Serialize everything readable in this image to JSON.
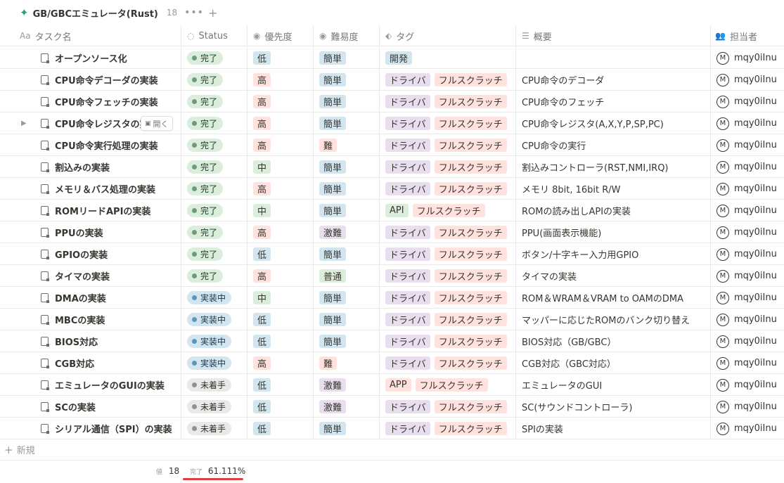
{
  "database": {
    "title": "GB/GBCエミュレータ(Rust)",
    "count": "18",
    "more": "•••",
    "add": "+"
  },
  "columns": [
    {
      "label": "タスク名",
      "icon": "Aa"
    },
    {
      "label": "Status",
      "icon": "◌"
    },
    {
      "label": "優先度",
      "icon": "◉"
    },
    {
      "label": "難易度",
      "icon": "◉"
    },
    {
      "label": "タグ",
      "icon": "⬖"
    },
    {
      "label": "概要",
      "icon": "☰"
    },
    {
      "label": "担当者",
      "icon": "👥"
    }
  ],
  "open_button": {
    "label": "開く",
    "icon": "▣"
  },
  "rows": [
    {
      "name": "オープンソース化",
      "status": "完了",
      "priority": "低",
      "difficulty": "簡単",
      "tags": [
        "開発"
      ],
      "summary": "",
      "owner": "mqy0iInu",
      "avatar": "M"
    },
    {
      "name": "CPU命令デコーダの実装",
      "status": "完了",
      "priority": "高",
      "difficulty": "簡単",
      "tags": [
        "ドライバ",
        "フルスクラッチ"
      ],
      "summary": "CPU命令のデコーダ",
      "owner": "mqy0iInu",
      "avatar": "M"
    },
    {
      "name": "CPU命令フェッチの実装",
      "status": "完了",
      "priority": "高",
      "difficulty": "簡単",
      "tags": [
        "ドライバ",
        "フルスクラッチ"
      ],
      "summary": "CPU命令のフェッチ",
      "owner": "mqy0iInu",
      "avatar": "M"
    },
    {
      "name": "CPU命令レジスタの実",
      "status": "完了",
      "priority": "高",
      "difficulty": "簡単",
      "tags": [
        "ドライバ",
        "フルスクラッチ"
      ],
      "summary": "CPU命令レジスタ(A,X,Y,P,SP,PC)",
      "owner": "mqy0iInu",
      "avatar": "M"
    },
    {
      "name": "CPU命令実行処理の実装",
      "status": "完了",
      "priority": "高",
      "difficulty": "難",
      "tags": [
        "ドライバ",
        "フルスクラッチ"
      ],
      "summary": "CPU命令の実行",
      "owner": "mqy0iInu",
      "avatar": "M"
    },
    {
      "name": "割込みの実装",
      "status": "完了",
      "priority": "中",
      "difficulty": "簡単",
      "tags": [
        "ドライバ",
        "フルスクラッチ"
      ],
      "summary": "割込みコントローラ(RST,NMI,IRQ)",
      "owner": "mqy0iInu",
      "avatar": "M"
    },
    {
      "name": "メモリ＆バス処理の実装",
      "status": "完了",
      "priority": "高",
      "difficulty": "簡単",
      "tags": [
        "ドライバ",
        "フルスクラッチ"
      ],
      "summary": "メモリ 8bit, 16bit R/W",
      "owner": "mqy0iInu",
      "avatar": "M"
    },
    {
      "name": "ROMリードAPIの実装",
      "status": "完了",
      "priority": "中",
      "difficulty": "簡単",
      "tags": [
        "API",
        "フルスクラッチ"
      ],
      "summary": "ROMの読み出しAPIの実装",
      "owner": "mqy0iInu",
      "avatar": "M"
    },
    {
      "name": "PPUの実装",
      "status": "完了",
      "priority": "高",
      "difficulty": "激難",
      "tags": [
        "ドライバ",
        "フルスクラッチ"
      ],
      "summary": "PPU(画面表示機能)",
      "owner": "mqy0iInu",
      "avatar": "M"
    },
    {
      "name": "GPIOの実装",
      "status": "完了",
      "priority": "低",
      "difficulty": "簡単",
      "tags": [
        "ドライバ",
        "フルスクラッチ"
      ],
      "summary": "ボタン/十字キー入力用GPIO",
      "owner": "mqy0iInu",
      "avatar": "M"
    },
    {
      "name": "タイマの実装",
      "status": "完了",
      "priority": "高",
      "difficulty": "普通",
      "tags": [
        "ドライバ",
        "フルスクラッチ"
      ],
      "summary": "タイマの実装",
      "owner": "mqy0iInu",
      "avatar": "M"
    },
    {
      "name": "DMAの実装",
      "status": "実装中",
      "priority": "中",
      "difficulty": "簡単",
      "tags": [
        "ドライバ",
        "フルスクラッチ"
      ],
      "summary": "ROM＆WRAM＆VRAM to OAMのDMA",
      "owner": "mqy0iInu",
      "avatar": "M"
    },
    {
      "name": "MBCの実装",
      "status": "実装中",
      "priority": "低",
      "difficulty": "簡単",
      "tags": [
        "ドライバ",
        "フルスクラッチ"
      ],
      "summary": "マッパーに応じたROMのバンク切り替え",
      "owner": "mqy0iInu",
      "avatar": "M"
    },
    {
      "name": "BIOS対応",
      "status": "実装中",
      "priority": "低",
      "difficulty": "簡単",
      "tags": [
        "ドライバ",
        "フルスクラッチ"
      ],
      "summary": "BIOS対応（GB/GBC）",
      "owner": "mqy0iInu",
      "avatar": "M"
    },
    {
      "name": "CGB対応",
      "status": "実装中",
      "priority": "高",
      "difficulty": "難",
      "tags": [
        "ドライバ",
        "フルスクラッチ"
      ],
      "summary": "CGB対応（GBC対応）",
      "owner": "mqy0iInu",
      "avatar": "M"
    },
    {
      "name": "エミュレータのGUIの実装",
      "status": "未着手",
      "priority": "低",
      "difficulty": "激難",
      "tags": [
        "APP",
        "フルスクラッチ"
      ],
      "summary": "エミュレータのGUI",
      "owner": "mqy0iInu",
      "avatar": "M"
    },
    {
      "name": "SCの実装",
      "status": "未着手",
      "priority": "低",
      "difficulty": "激難",
      "tags": [
        "ドライバ",
        "フルスクラッチ"
      ],
      "summary": "SC(サウンドコントローラ)",
      "owner": "mqy0iInu",
      "avatar": "M"
    },
    {
      "name": "シリアル通信（SPI）の実装",
      "status": "未着手",
      "priority": "低",
      "difficulty": "簡単",
      "tags": [
        "ドライバ",
        "フルスクラッチ"
      ],
      "summary": "SPIの実装",
      "owner": "mqy0iInu",
      "avatar": "M"
    }
  ],
  "new_row": {
    "label": "新規",
    "icon": "+"
  },
  "footer": {
    "count_label": "値",
    "count_value": "18",
    "pct_label": "完了",
    "pct_value": "61.111%"
  },
  "colors": {
    "status": {
      "完了": {
        "bg": "#dbeddb",
        "dot": "#6c9b7d",
        "text": "#1c3829"
      },
      "実装中": {
        "bg": "#d3e5ef",
        "dot": "#5b97bd",
        "text": "#183347"
      },
      "未着手": {
        "bg": "#e9e9e7",
        "dot": "#91918e",
        "text": "#32302c"
      }
    },
    "select": {
      "低": "#d3e5ef",
      "中": "#dbeddb",
      "高": "#ffe2dd",
      "簡単": "#d3e5ef",
      "普通": "#dbeddb",
      "難": "#ffe2dd",
      "激難": "#e8deee",
      "開発": "#d3e5ef",
      "ドライバ": "#e8deee",
      "フルスクラッチ": "#ffe2dd",
      "API": "#dbeddb",
      "APP": "#ffe2dd"
    },
    "accent_underline": "#e03e3e",
    "title_icon": "#2e9e78"
  }
}
